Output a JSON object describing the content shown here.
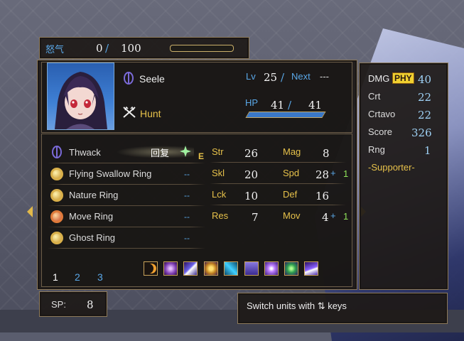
{
  "rage": {
    "label": "怒气",
    "current": "0",
    "sep": "/",
    "max": "100",
    "fill": 0.0
  },
  "unit": {
    "name": "Seele",
    "class": "Hunt",
    "lv_label": "Lv",
    "lv": "25",
    "next_sep": "/",
    "next_label": "Next",
    "next_value": "---",
    "hp_label": "HP",
    "hp_current": "41",
    "hp_sep": "/",
    "hp_max": "41",
    "hp_fill": 1.0
  },
  "side": {
    "dmg_label": "DMG",
    "dmg_type": "PHY",
    "dmg_value": "40",
    "crt_label": "Crt",
    "crt_value": "22",
    "crtavo_label": "Crtavo",
    "crtavo_value": "22",
    "score_label": "Score",
    "score_value": "326",
    "rng_label": "Rng",
    "rng_value": "1",
    "role": "-Supporter-"
  },
  "items": [
    {
      "name": "Thwack",
      "uses": "",
      "icon": "weapon-icon"
    },
    {
      "name": "Flying Swallow Ring",
      "uses": "--",
      "icon": "ring-icon"
    },
    {
      "name": "Nature Ring",
      "uses": "--",
      "icon": "ring-icon"
    },
    {
      "name": "Move Ring",
      "uses": "--",
      "icon": "ring-icon"
    },
    {
      "name": "Ghost Ring",
      "uses": "--",
      "icon": "ring-icon"
    }
  ],
  "equip_tag": {
    "text": "回复",
    "marker": "E"
  },
  "stats": {
    "str_label": "Str",
    "str_value": "26",
    "mag_label": "Mag",
    "mag_value": "8",
    "skl_label": "Skl",
    "skl_value": "20",
    "spd_label": "Spd",
    "spd_value": "28",
    "spd_plus": "+",
    "spd_bonus": "1",
    "lck_label": "Lck",
    "lck_value": "10",
    "def_label": "Def",
    "def_value": "16",
    "res_label": "Res",
    "res_value": "7",
    "mov_label": "Mov",
    "mov_value": "4",
    "mov_plus": "+",
    "mov_bonus": "1"
  },
  "pages": [
    "1",
    "2",
    "3"
  ],
  "skills": [
    "crescent-icon",
    "orb-icon",
    "slash-icon",
    "gold-icon",
    "crystal-icon",
    "swap-icon",
    "burst-icon",
    "gem-icon",
    "beam-icon"
  ],
  "sp": {
    "label": "SP:",
    "value": "8"
  },
  "hint": {
    "text": "Switch units with ⇅ keys"
  },
  "colors": {
    "gold": "#e6c14a",
    "blue": "#5aa8e8",
    "green": "#8fe25a",
    "hp_bar": "#3a78c8"
  }
}
